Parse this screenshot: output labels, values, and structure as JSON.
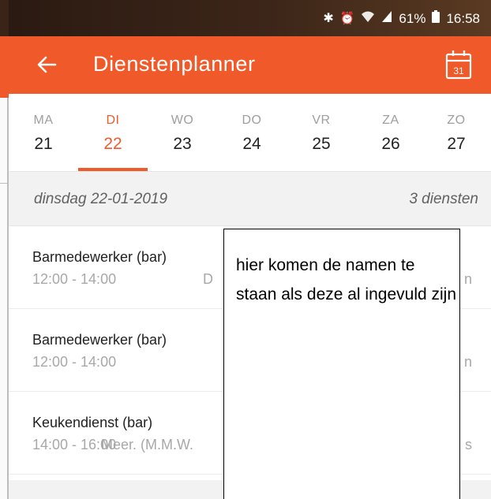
{
  "status_bar": {
    "icons": [
      "bluetooth-icon",
      "alarm-icon",
      "wifi-icon",
      "signal-icon",
      "battery-icon"
    ],
    "battery": "61%",
    "time": "16:58"
  },
  "app_bar": {
    "title": "Dienstenplanner",
    "calendar_day": "31"
  },
  "week": [
    {
      "name": "MA",
      "date": "21",
      "active": false
    },
    {
      "name": "DI",
      "date": "22",
      "active": true
    },
    {
      "name": "WO",
      "date": "23",
      "active": false
    },
    {
      "name": "DO",
      "date": "24",
      "active": false
    },
    {
      "name": "VR",
      "date": "25",
      "active": false
    },
    {
      "name": "ZA",
      "date": "26",
      "active": false
    },
    {
      "name": "ZO",
      "date": "27",
      "active": false
    }
  ],
  "day_header": {
    "date_label": "dinsdag 22-01-2019",
    "count_label": "3 diensten"
  },
  "shifts": [
    {
      "name": "Barmedewerker (bar)",
      "time": "12:00 - 14:00",
      "people": "D",
      "right": "n"
    },
    {
      "name": "Barmedewerker (bar)",
      "time": "12:00 - 14:00",
      "people": "",
      "right": "n"
    },
    {
      "name": "Keukendienst (bar)",
      "time": "14:00 - 16:00",
      "people": "Meer. (M.M.W.",
      "right": "s"
    }
  ],
  "annotation": {
    "text": "hier komen de namen te staan als deze al ingevuld zijn"
  },
  "colors": {
    "accent": "#f0592a",
    "status_bar": "#3a2418",
    "muted_text": "#a8a8a8"
  }
}
